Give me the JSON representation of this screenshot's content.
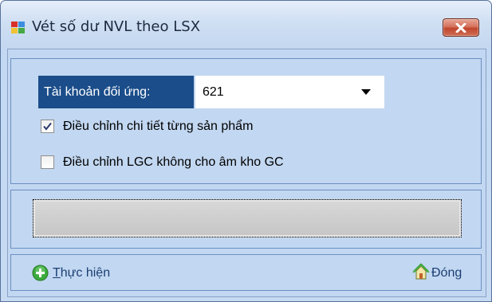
{
  "window": {
    "title": "Vét số dư NVL theo LSX",
    "app_icon": "window-app-icon",
    "close_icon": "close-x-icon"
  },
  "form": {
    "account_label": "Tài khoản đối ứng:",
    "account_value": "621",
    "account_dropdown_icon": "chevron-down-icon",
    "checkbox_detail": {
      "label": "Điều chỉnh chi tiết từng sản phẩm",
      "checked": true
    },
    "checkbox_lgc": {
      "label": "Điều chỉnh LGC không cho âm kho GC",
      "checked": false
    }
  },
  "progress": {
    "value_percent": 0
  },
  "footer": {
    "run_first_letter": "T",
    "run_rest": "hực hiện",
    "run_icon": "green-plus-circle-icon",
    "close_text": "Đón",
    "close_underlined": "g",
    "close_icon": "home-icon"
  },
  "colors": {
    "label_bg": "#1a4d8a",
    "panel_bg": "#c2d7f1",
    "panel_border": "#6c8fc3",
    "close_button": "#c0462c",
    "link_text": "#1b3f73"
  }
}
